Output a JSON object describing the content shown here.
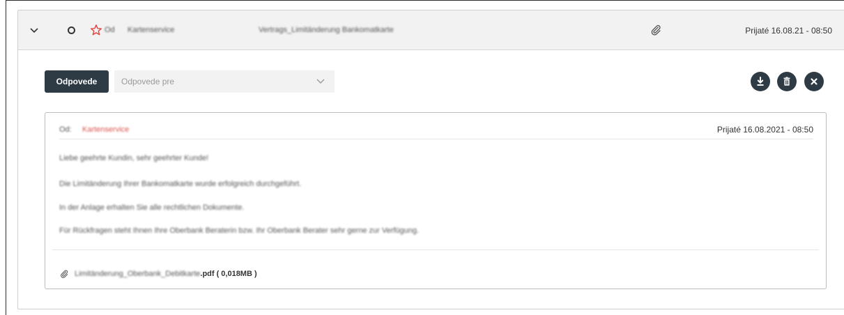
{
  "header": {
    "expand_icon": "chevron-down-icon",
    "status_icon": "circle-outline-icon",
    "star_icon": "star-outline-icon",
    "star_color": "#e53935",
    "tag": "Od",
    "sender": "Kartenservice",
    "subject": "Vertrags_Limitänderung Bankomatkarte",
    "attachment_icon": "paperclip-icon",
    "received": "Prijaté 16.08.21 - 08:50"
  },
  "toolbar": {
    "reply_label": "Odpovede",
    "reply_for_placeholder": "Odpovede pre",
    "download_icon": "download-icon",
    "delete_icon": "trash-icon",
    "close_icon": "close-icon",
    "accent_color": "#2e3b45"
  },
  "message": {
    "from_prefix": "Od:",
    "from": "Kartenservice",
    "from_color": "#d9534f",
    "received": "Prijaté 16.08.2021 - 08:50",
    "body": [
      "Liebe geehrte Kundin, sehr geehrter Kunde!",
      "Die Limitänderung Ihrer Bankomatkarte wurde erfolgreich durchgeführt.",
      "In der Anlage erhalten Sie alle rechtlichen Dokumente.",
      "Für Rückfragen steht Ihnen Ihre Oberbank Beraterin bzw. Ihr Oberbank Berater sehr gerne zur Verfügung."
    ],
    "attachment": {
      "icon": "paperclip-icon",
      "name": "Limitänderung_Oberbank_Debitkarte",
      "ext": ".pdf",
      "size": "( 0,018MB )"
    }
  }
}
